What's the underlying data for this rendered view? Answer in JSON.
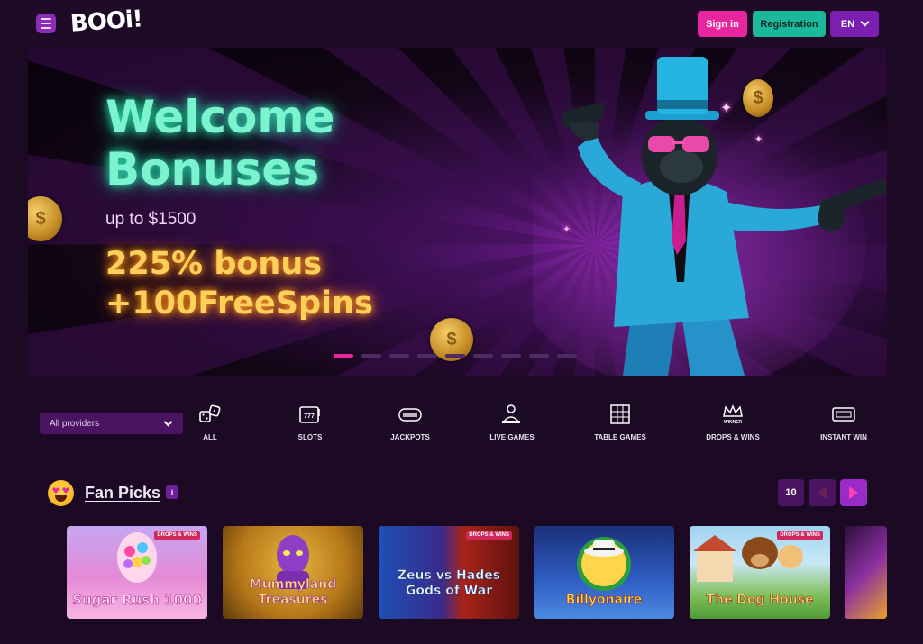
{
  "header": {
    "logo": "BOOi!",
    "sign_in": "Sign in",
    "registration": "Registration",
    "language": "EN"
  },
  "banner": {
    "headline": "Welcome Bonuses",
    "upto": "up to $1500",
    "bonus_line1": "225% bonus",
    "bonus_line2": "+100FreeSpins",
    "slide_count": 9,
    "active_slide": 1
  },
  "filters": {
    "providers_label": "All providers",
    "categories": [
      {
        "label": "ALL",
        "icon": "dice-icon"
      },
      {
        "label": "SLOTS",
        "icon": "slot-machine-icon"
      },
      {
        "label": "JACKPOTS",
        "icon": "jackpot-icon"
      },
      {
        "label": "LIVE GAMES",
        "icon": "live-dealer-icon"
      },
      {
        "label": "TABLE GAMES",
        "icon": "table-grid-icon"
      },
      {
        "label": "DROPS & WINS",
        "icon": "crown-winner-icon"
      },
      {
        "label": "INSTANT WIN",
        "icon": "ticket-icon"
      }
    ]
  },
  "section": {
    "title": "Fan Picks",
    "info": "i",
    "count": "10"
  },
  "games": [
    {
      "title": "Sugar Rush 1000",
      "tag": "DROPS & WINS",
      "bg": "#e58ad8",
      "color": "#ffd6f3"
    },
    {
      "title": "Mummyland Treasures",
      "tag": "",
      "bg": "#c7901d",
      "color": "#ffe066"
    },
    {
      "title": "Zeus vs Hades Gods of War",
      "tag": "DROPS & WINS",
      "bg": "#7a1e16",
      "color": "#9fe6ff"
    },
    {
      "title": "Billyonaire",
      "tag": "",
      "bg": "#2747a3",
      "color": "#ffd54a"
    },
    {
      "title": "The Dog House",
      "tag": "DROPS & WINS",
      "bg": "#7fbf5a",
      "color": "#ffcf6a"
    }
  ]
}
